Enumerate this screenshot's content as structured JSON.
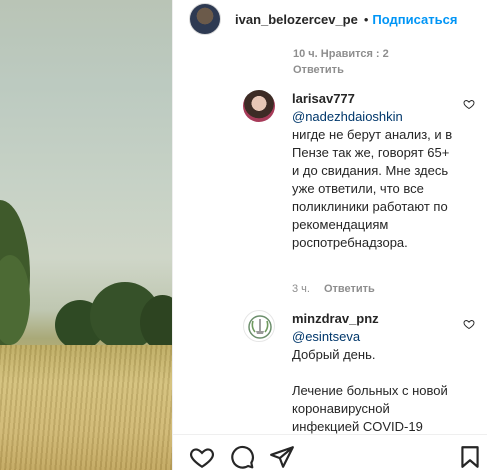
{
  "post": {
    "username": "ivan_belozercev_pe",
    "separator": "•",
    "follow_label": "Подписаться"
  },
  "previous_comment": {
    "meta": "10 ч.    Нравится : 2",
    "reply_label": "Ответить"
  },
  "comments": [
    {
      "username": "larisav777",
      "mention": "@nadezhdaioshkin",
      "text": "нигде не берут анализ, и в Пензе так же, говорят 65+ и до свидания. Мне здесь уже ответили, что все поликлиники работают по рекомендациям роспотребнадзора.",
      "time": "3 ч.",
      "reply_label": "Ответить"
    },
    {
      "username": "minzdrav_pnz",
      "mention": "@esintseva",
      "text_1": "Добрый день.",
      "text_2": "Лечение больных с новой коронавирусной инфекцией COVID-19"
    }
  ],
  "icons": {
    "like": "heart-icon",
    "comment": "comment-icon",
    "share": "share-icon",
    "save": "bookmark-icon",
    "comment_like": "heart-icon"
  },
  "colors": {
    "link": "#0095f6",
    "mention": "#00376b",
    "muted": "#8e8e8e"
  }
}
